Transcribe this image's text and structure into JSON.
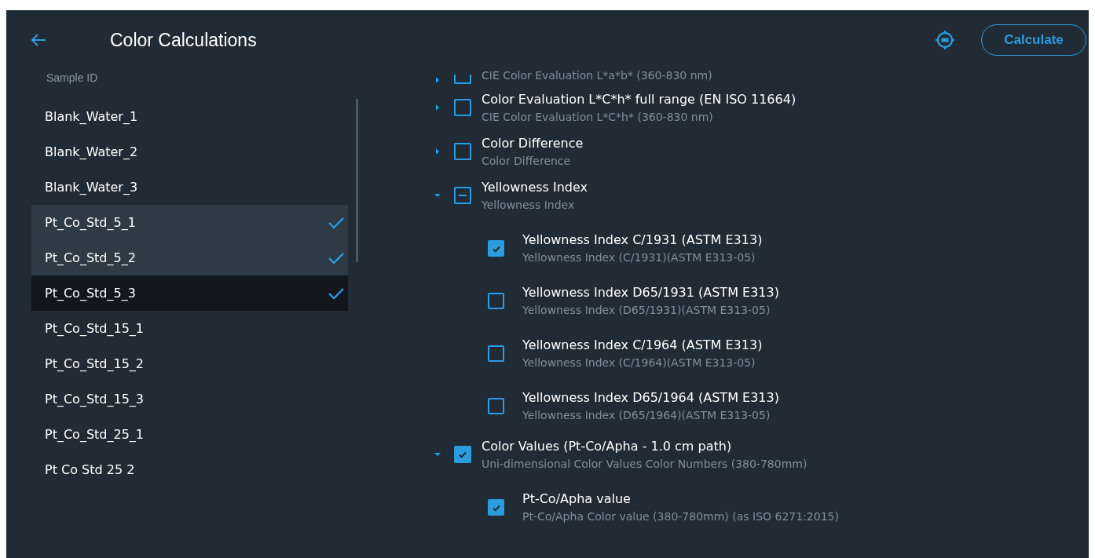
{
  "header": {
    "title": "Color Calculations",
    "button": "Calculate"
  },
  "samples": {
    "heading": "Sample ID",
    "items": [
      {
        "label": "Blank_Water_1",
        "checked": false,
        "focused": false
      },
      {
        "label": "Blank_Water_2",
        "checked": false,
        "focused": false
      },
      {
        "label": "Blank_Water_3",
        "checked": false,
        "focused": false
      },
      {
        "label": "Pt_Co_Std_5_1",
        "checked": true,
        "focused": false
      },
      {
        "label": "Pt_Co_Std_5_2",
        "checked": true,
        "focused": false
      },
      {
        "label": "Pt_Co_Std_5_3",
        "checked": true,
        "focused": true
      },
      {
        "label": "Pt_Co_Std_15_1",
        "checked": false,
        "focused": false
      },
      {
        "label": "Pt_Co_Std_15_2",
        "checked": false,
        "focused": false
      },
      {
        "label": "Pt_Co_Std_15_3",
        "checked": false,
        "focused": false
      },
      {
        "label": "Pt_Co_Std_25_1",
        "checked": false,
        "focused": false
      },
      {
        "label": "Pt Co Std 25 2",
        "checked": false,
        "focused": false
      }
    ]
  },
  "calculations": [
    {
      "subtitle": "CIE Color Evaluation L*a*b* (360-830 nm)",
      "expanded": false,
      "checked": false,
      "indeterminate": false
    },
    {
      "title": "Color Evaluation L*C*h* full range (EN ISO 11664)",
      "subtitle": "CIE Color Evaluation L*C*h* (360-830 nm)",
      "expanded": false,
      "checked": false,
      "indeterminate": false
    },
    {
      "title": "Color Difference",
      "subtitle": "Color Difference",
      "expanded": false,
      "checked": false,
      "indeterminate": false
    },
    {
      "title": "Yellowness Index",
      "subtitle": "Yellowness Index",
      "expanded": true,
      "checked": false,
      "indeterminate": true,
      "children": [
        {
          "title": "Yellowness Index C/1931 (ASTM E313)",
          "subtitle": "Yellowness Index (C/1931)(ASTM E313-05)",
          "checked": true
        },
        {
          "title": "Yellowness Index D65/1931 (ASTM E313)",
          "subtitle": "Yellowness Index (D65/1931)(ASTM E313-05)",
          "checked": false
        },
        {
          "title": "Yellowness Index C/1964 (ASTM E313)",
          "subtitle": "Yellowness Index (C/1964)(ASTM E313-05)",
          "checked": false
        },
        {
          "title": "Yellowness Index D65/1964 (ASTM E313)",
          "subtitle": "Yellowness Index (D65/1964)(ASTM E313-05)",
          "checked": false
        }
      ]
    },
    {
      "title": "Color Values (Pt-Co/Apha - 1.0 cm path)",
      "subtitle": "Uni-dimensional Color Values Color Numbers (380-780mm)",
      "expanded": true,
      "checked": true,
      "indeterminate": false,
      "children": [
        {
          "title": "Pt-Co/Apha value",
          "subtitle": "Pt-Co/Apha Color value (380-780mm) (as ISO 6271:2015)",
          "checked": true
        }
      ]
    }
  ]
}
